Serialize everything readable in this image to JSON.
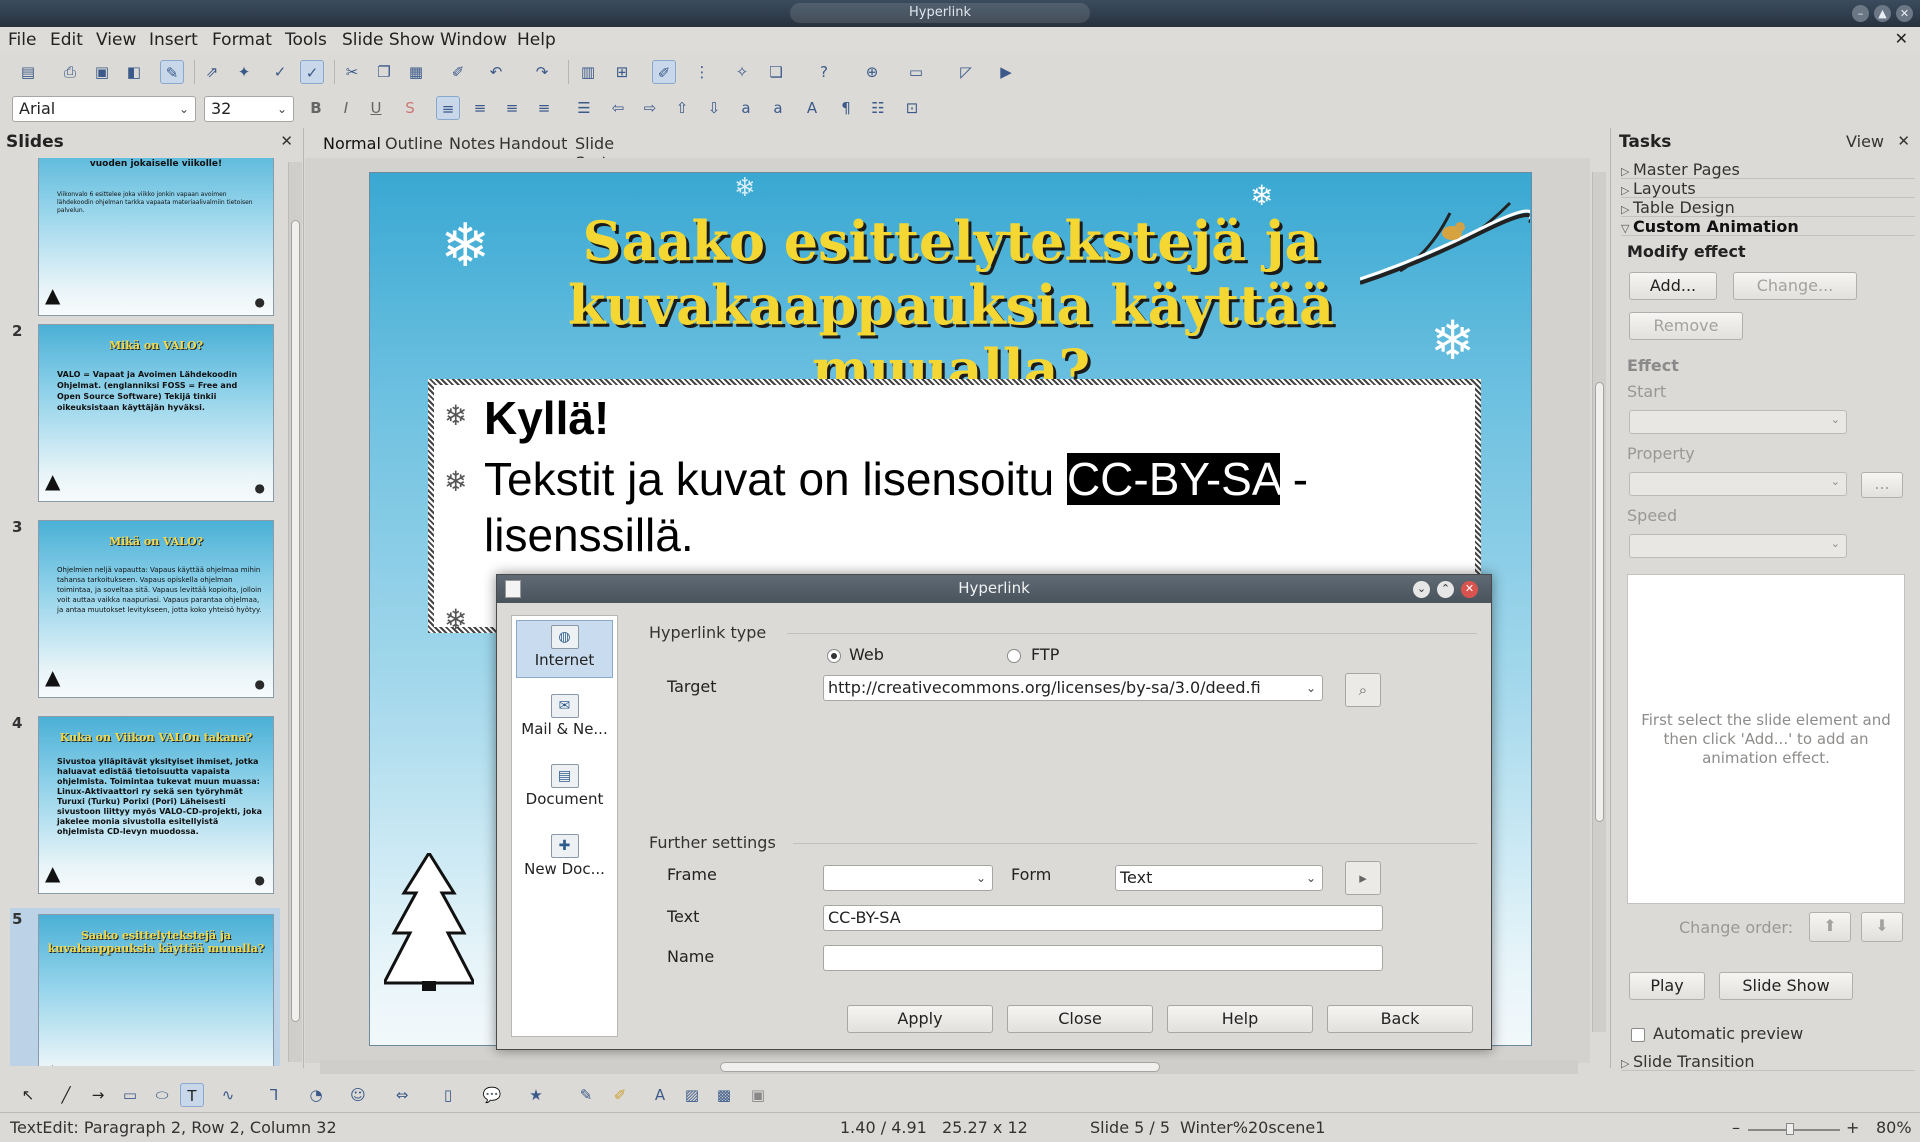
{
  "window": {
    "title": "Hyperlink"
  },
  "menu": [
    "File",
    "Edit",
    "View",
    "Insert",
    "Format",
    "Tools",
    "Slide Show",
    "Window",
    "Help"
  ],
  "format_bar": {
    "font_name": "Arial",
    "font_size": "32"
  },
  "slides_pane": {
    "title": "Slides",
    "slides": [
      {
        "num": "",
        "title": "Vapaita avoimen lähdekoodin ohjelmia vuoden jokaiselle viikolle!",
        "body": "Viikonvalo 6 esittelee joka viikko jonkin vapaan avoimen lähdekoodin ohjelman tarkka vapaata materiaalivalmiin tietoisen palvelun."
      },
      {
        "num": "2",
        "title": "Mikä on VALO?",
        "body": "VALO = Vapaat ja Avoimen Lähdekoodin Ohjelmat. (englanniksi FOSS = Free and Open Source Software) Tekijä tinkii oikeuksistaan käyttäjän hyväksi."
      },
      {
        "num": "3",
        "title": "Mikä on VALO?",
        "body": "Ohjelmien neljä vapautta: Vapaus käyttää ohjelmaa mihin tahansa tarkoitukseen. Vapaus opiskella ohjelman toimintaa, ja soveltaa sitä. Vapaus levittää kopioita, jolloin voit auttaa vaikka naapuriasi. Vapaus parantaa ohjelmaa, ja antaa muutokset levitykseen, jotta koko yhteisö hyötyy."
      },
      {
        "num": "4",
        "title": "Kuka on Viikon VALOn takana?",
        "body": "Sivustoa ylläpitävät yksityiset ihmiset, jotka haluavat edistää tietoisuutta vapaista ohjelmista. Toimintaa tukevat muun muassa: Linux-Aktivaattori ry sekä sen työryhmät Turuxi (Turku) Porixi (Pori) Läheisesti sivustoon liittyy myös VALO-CD-projekti, joka jakelee monia sivustolla esitellyistä ohjelmista CD-levyn muodossa."
      },
      {
        "num": "5",
        "title": "Saako esittelytekstejä ja kuvakaappauksia käyttää muualla?",
        "body": ""
      }
    ]
  },
  "view_tabs": [
    "Normal",
    "Outline",
    "Notes",
    "Handout",
    "Slide Sorter"
  ],
  "slide": {
    "title": "Saako esittelytekstejä ja kuvakaappauksia käyttää muualla?",
    "bullet1": "Kyllä!",
    "bullet2_pre": "Tekstit ja kuvat on lisensoitu ",
    "bullet2_sel": "CC-BY-SA",
    "bullet2_post": " -lisenssillä."
  },
  "dialog": {
    "title": "Hyperlink",
    "sidebar": [
      "Internet",
      "Mail & Ne...",
      "Document",
      "New Doc..."
    ],
    "hyperlink_type_label": "Hyperlink type",
    "radio_web": "Web",
    "radio_ftp": "FTP",
    "target_label": "Target",
    "target_value": "http://creativecommons.org/licenses/by-sa/3.0/deed.fi",
    "further_label": "Further settings",
    "frame_label": "Frame",
    "frame_value": "",
    "form_label": "Form",
    "form_value": "Text",
    "text_label": "Text",
    "text_value": "CC-BY-SA",
    "name_label": "Name",
    "name_value": "",
    "buttons": {
      "apply": "Apply",
      "close": "Close",
      "help": "Help",
      "back": "Back"
    }
  },
  "tasks": {
    "title": "Tasks",
    "view": "View",
    "sections": [
      "Master Pages",
      "Layouts",
      "Table Design",
      "Custom Animation",
      "Slide Transition"
    ],
    "modify_effect": "Modify effect",
    "add": "Add...",
    "change": "Change...",
    "remove": "Remove",
    "effect": "Effect",
    "start": "Start",
    "property": "Property",
    "property_btn": "...",
    "speed": "Speed",
    "list_hint": "First select the slide element and then click 'Add...' to add an animation effect.",
    "change_order": "Change order:",
    "play": "Play",
    "slide_show": "Slide Show",
    "auto_preview": "Automatic preview"
  },
  "status": {
    "mode": "TextEdit: Paragraph 2, Row 2, Column 32",
    "position": "1.40 / 4.91",
    "size": "25.27 x 12",
    "slide": "Slide 5 / 5",
    "master": "Winter%20scene1",
    "zoom": "80%"
  }
}
